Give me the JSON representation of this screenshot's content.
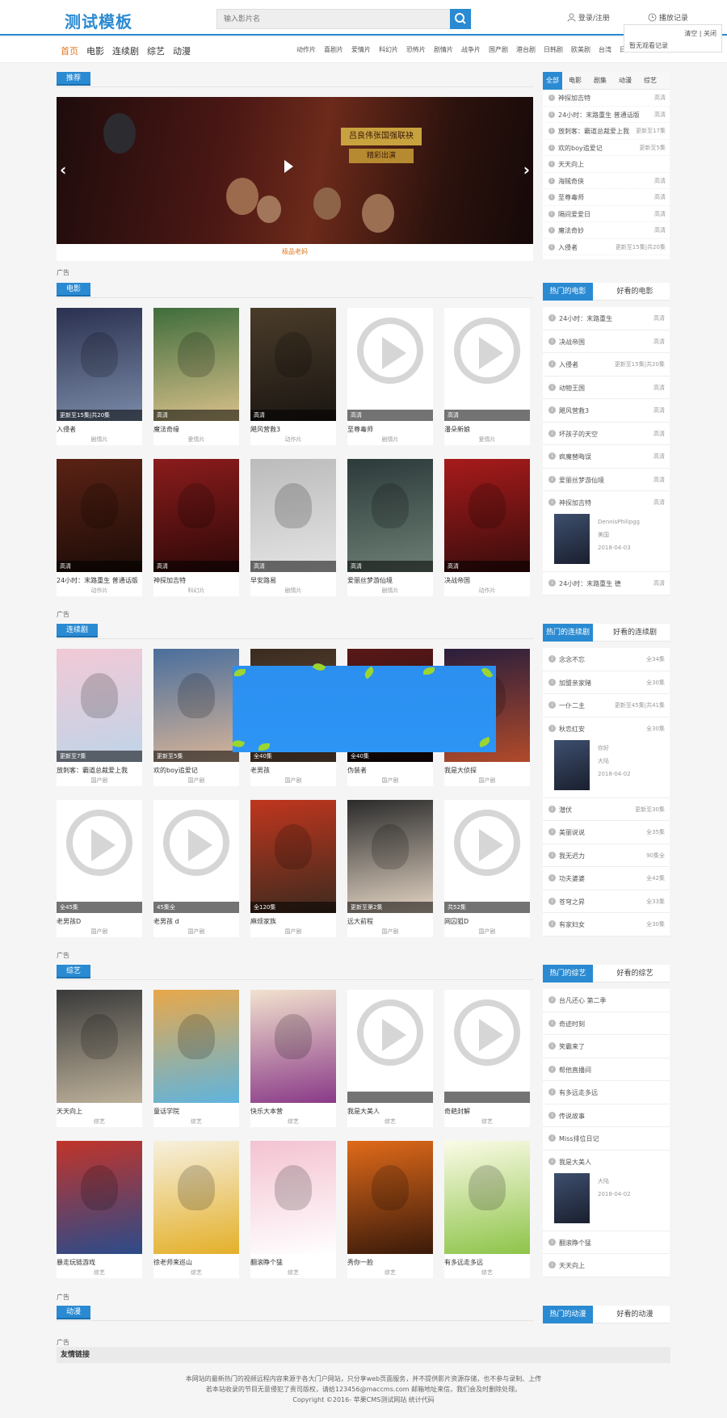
{
  "header": {
    "logo": "测试模板",
    "search_placeholder": "输入影片名",
    "login": "登录/注册",
    "history": "播放记录",
    "history_clear": "清空 | 关闭",
    "history_empty": "暂无观看记录"
  },
  "nav": {
    "main": [
      "首页",
      "电影",
      "连续剧",
      "综艺",
      "动漫"
    ],
    "sub": [
      "动作片",
      "喜剧片",
      "爱情片",
      "科幻片",
      "恐怖片",
      "剧情片",
      "战争片",
      "国产剧",
      "港台剧",
      "日韩剧",
      "欧美剧",
      "台湾",
      "日本",
      "欧美",
      "韩国"
    ]
  },
  "recommend": {
    "tag": "推荐",
    "slide_caption": "极品老妈",
    "slide_title1": "吕良伟张国强联袂",
    "slide_title2": "精彩出演"
  },
  "ad_label": "广告",
  "top_side": {
    "tabs": [
      "全部",
      "电影",
      "剧集",
      "动漫",
      "综艺"
    ],
    "items": [
      {
        "name": "神探加吉特",
        "status": "高清"
      },
      {
        "name": "24小时：末路重生 普通话版",
        "status": "高清"
      },
      {
        "name": "放刺客：霸道总裁爱上我",
        "status": "更新至17集"
      },
      {
        "name": "欢的boy追爱记",
        "status": "更新至5集"
      },
      {
        "name": "天天向上",
        "status": ""
      },
      {
        "name": "海贼奇侠",
        "status": "高清"
      },
      {
        "name": "至尊毒师",
        "status": "高清"
      },
      {
        "name": "隔间爱爱日",
        "status": "高清"
      },
      {
        "name": "魔法奇妙",
        "status": "高清"
      },
      {
        "name": "入侵者",
        "status": "更新至15集|共20集"
      }
    ]
  },
  "movie": {
    "tag": "电影",
    "side_tabs": [
      "热门的电影",
      "好看的电影"
    ],
    "cards": [
      {
        "title": "入侵者",
        "sub": "剧情片",
        "badge": "更新至15集|共20集"
      },
      {
        "title": "魔法奇缘",
        "sub": "爱情片",
        "badge": "高清"
      },
      {
        "title": "飓风营救3",
        "sub": "动作片",
        "badge": "高清"
      },
      {
        "title": "至尊毒师",
        "sub": "剧情片",
        "badge": "高清"
      },
      {
        "title": "潘朵新娘",
        "sub": "爱情片",
        "badge": "高清"
      },
      {
        "title": "24小时：末路重生 普通话版",
        "sub": "动作片",
        "badge": "高清"
      },
      {
        "title": "神探加吉特",
        "sub": "科幻片",
        "badge": "高清"
      },
      {
        "title": "早安路易",
        "sub": "剧情片",
        "badge": "高清"
      },
      {
        "title": "爱丽丝梦游仙境",
        "sub": "剧情片",
        "badge": "高清"
      },
      {
        "title": "决战帝国",
        "sub": "动作片",
        "badge": "高清"
      }
    ],
    "rank": [
      {
        "name": "24小时：末路重生",
        "status": "高清"
      },
      {
        "name": "决战帝国",
        "status": "高清"
      },
      {
        "name": "入侵者",
        "status": "更新至15集|共20集"
      },
      {
        "name": "动物王国",
        "status": "高清"
      },
      {
        "name": "飓风营救3",
        "status": "高清"
      },
      {
        "name": "坏孩子的天空",
        "status": "高清"
      },
      {
        "name": "疯魔替晦误",
        "status": "高清"
      },
      {
        "name": "爱丽丝梦游仙境",
        "status": "高清"
      }
    ],
    "rank_big": {
      "name": "神探加吉特",
      "status": "高清",
      "info1": "DennisPhilipgg",
      "info2": "美国",
      "info3": "2018-04-03"
    },
    "rank_last": {
      "name": "24小时：末路重生 德",
      "status": "高清"
    }
  },
  "series": {
    "tag": "连续剧",
    "side_tabs": [
      "热门的连续剧",
      "好看的连续剧"
    ],
    "cards": [
      {
        "title": "放刺客：霸道总裁爱上我",
        "sub": "国产剧",
        "badge": "更新至7集"
      },
      {
        "title": "欢的boy追爱记",
        "sub": "国产剧",
        "badge": "更新至5集"
      },
      {
        "title": "老男孩",
        "sub": "国产剧",
        "badge": "全40集"
      },
      {
        "title": "伪装者",
        "sub": "国产剧",
        "badge": "全40集"
      },
      {
        "title": "我是大侦探",
        "sub": "国产剧",
        "badge": ""
      },
      {
        "title": "老男孩D",
        "sub": "国产剧",
        "badge": "全45集"
      },
      {
        "title": "老男孩 d",
        "sub": "国产剧",
        "badge": "45集全"
      },
      {
        "title": "麻烦家族",
        "sub": "国产剧",
        "badge": "全120集"
      },
      {
        "title": "远大前程",
        "sub": "国产剧",
        "badge": "更新至第2集"
      },
      {
        "title": "网囚狙D",
        "sub": "国产剧",
        "badge": "共52集"
      }
    ],
    "rank": [
      {
        "name": "念念不忘",
        "status": "全34集"
      },
      {
        "name": "加盟亲家赌",
        "status": "全30集"
      },
      {
        "name": "一仆二主",
        "status": "更新至45集|共41集"
      }
    ],
    "rank_big": {
      "name": "秋恋红安",
      "status": "全30集",
      "info1": "你好",
      "info2": "大陆",
      "info3": "2018-04-02"
    },
    "rank_more": [
      {
        "name": "潜伏",
        "status": "更新至30集"
      },
      {
        "name": "美丽说说",
        "status": "全35集"
      },
      {
        "name": "我无迟力",
        "status": "90集全"
      },
      {
        "name": "功夫婆婆",
        "status": "全42集"
      },
      {
        "name": "苍穹之昇",
        "status": "全33集"
      },
      {
        "name": "有家妇女",
        "status": "全30集"
      }
    ]
  },
  "variety": {
    "tag": "综艺",
    "side_tabs": [
      "热门的综艺",
      "好看的综艺"
    ],
    "cards": [
      {
        "title": "天天向上",
        "sub": "综艺",
        "badge": ""
      },
      {
        "title": "童话学院",
        "sub": "综艺",
        "badge": ""
      },
      {
        "title": "快乐大本营",
        "sub": "综艺",
        "badge": ""
      },
      {
        "title": "我是大美人",
        "sub": "综艺",
        "badge": ""
      },
      {
        "title": "奇葩封解",
        "sub": "综艺",
        "badge": ""
      },
      {
        "title": "暴走玩链游戏",
        "sub": "综艺",
        "badge": ""
      },
      {
        "title": "徐老师来巡山",
        "sub": "综艺",
        "badge": ""
      },
      {
        "title": "翻滚睁个猛",
        "sub": "综艺",
        "badge": ""
      },
      {
        "title": "秀你一脸",
        "sub": "综艺",
        "badge": ""
      },
      {
        "title": "有多远走多远",
        "sub": "综艺",
        "badge": ""
      }
    ],
    "rank": [
      {
        "name": "台凡还心 第二季",
        "status": ""
      },
      {
        "name": "奇迹时刻",
        "status": ""
      },
      {
        "name": "笑霸来了",
        "status": ""
      },
      {
        "name": "帮他直播间",
        "status": ""
      },
      {
        "name": "有多远走多远",
        "status": ""
      },
      {
        "name": "传说故事",
        "status": ""
      },
      {
        "name": "Miss排位日记",
        "status": ""
      }
    ],
    "rank_big": {
      "name": "我是大美人",
      "status": "",
      "info1": "",
      "info2": "大陆",
      "info3": "2018-04-02"
    },
    "rank_more": [
      {
        "name": "翻滚睁个猛",
        "status": ""
      },
      {
        "name": "天天向上",
        "status": ""
      }
    ]
  },
  "anime": {
    "tag": "动漫",
    "side_tabs": [
      "热门的动漫",
      "好看的动漫"
    ]
  },
  "friend_links": "友情链接",
  "footer": {
    "line1": "本网站的最新热门的视频远程内容来源于各大门户网站，只分享web页面服务，并不提供影片资源存储，也不参与录制、上传",
    "line2": "若本站收录的节目无意侵犯了贵司版权，请给123456@maccms.com 邮箱地址来信，我们会及时删除处理。",
    "line3": "Copyright ©2016- 苹果CMS测试网站 统计代码"
  },
  "colors": {
    "accent": "#2a8ad2",
    "orange": "#e2771f"
  }
}
